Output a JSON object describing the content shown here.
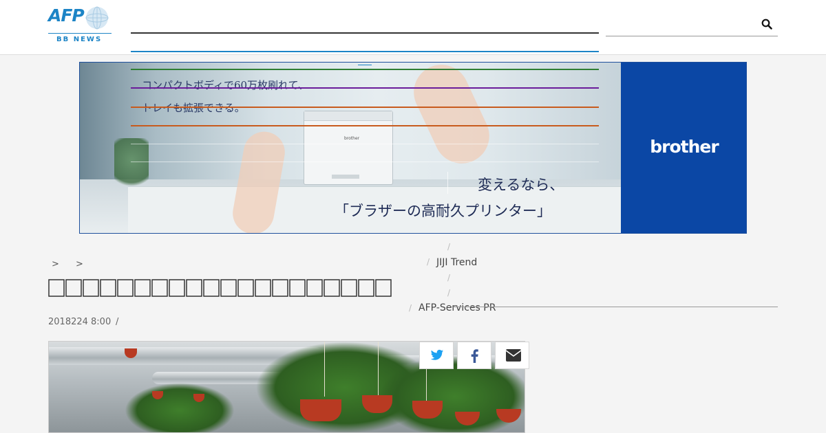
{
  "header": {
    "logo_text": "AFP",
    "logo_sub": "BB NEWS",
    "search_icon": "search-icon"
  },
  "banner": {
    "copy_line1": "コンパクトボディで60万枚刷れて、",
    "copy_line2": "トレイも拡張できる。",
    "copy_line3": "変えるなら、",
    "copy_line4": "「ブラザーの高耐久プリンター」",
    "printer_label": "brother",
    "brand": "brother",
    "brand_color": "#0b47a5"
  },
  "menu_remnants": {
    "jiji": "JIJI Trend",
    "afp_services": "AFP-Services PR",
    "slash": "/"
  },
  "breadcrumb": {
    "sep1": ">",
    "sep2": ">"
  },
  "article": {
    "title": "",
    "date": "2018224 8:00",
    "date_sep": "/"
  },
  "share": {
    "twitter": "twitter-icon",
    "facebook": "facebook-icon",
    "mail": "mail-icon"
  },
  "colors": {
    "afp_blue": "#1c84c6",
    "twitter": "#1da1f2",
    "facebook": "#3b5998"
  }
}
